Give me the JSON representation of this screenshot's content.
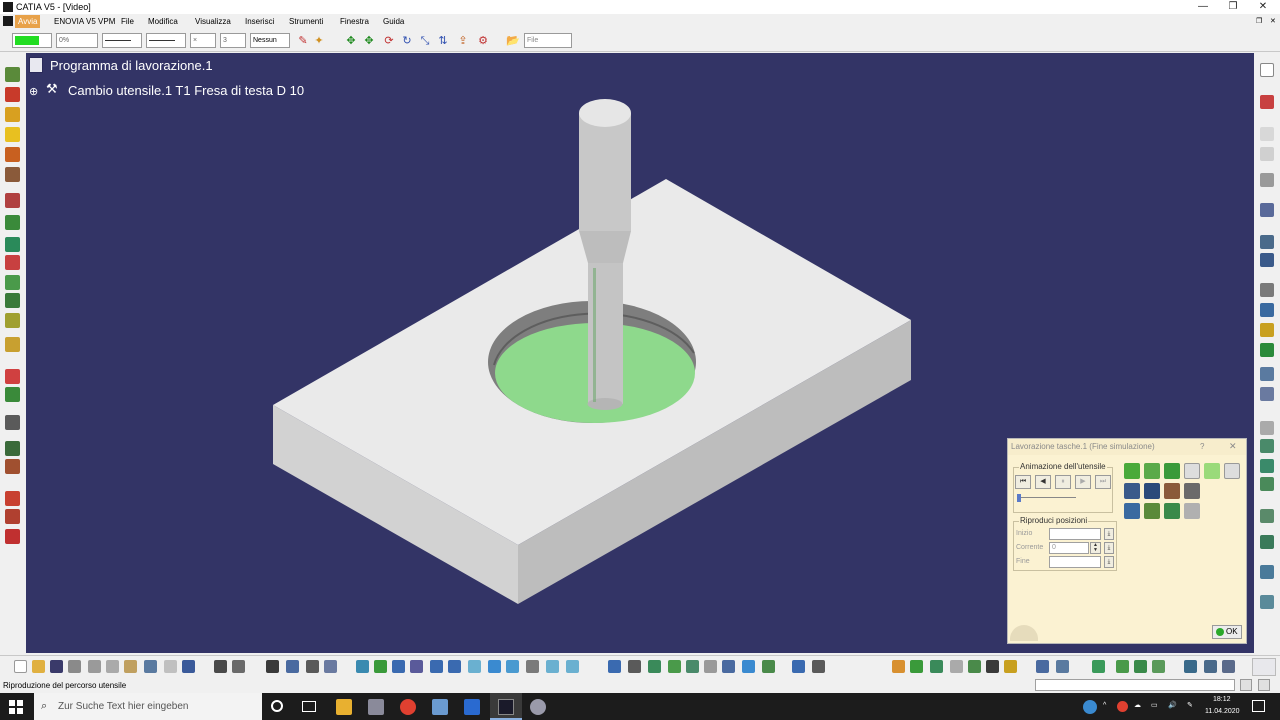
{
  "window": {
    "title": "CATIA V5 - [Video]",
    "controls": [
      "—",
      "❐",
      "✕"
    ]
  },
  "menubar": {
    "items": [
      "Avvia",
      "ENOVIA V5 VPM",
      "File",
      "Modifica",
      "Visualizza",
      "Inserisci",
      "Strumenti",
      "Finestra",
      "Guida"
    ],
    "active": "Avvia"
  },
  "toolbar_top": {
    "color_value": "",
    "color_swatch": "#22dd22",
    "transparency": "0%",
    "layer": "Nessun",
    "file_filter": "File"
  },
  "tree": {
    "root": "Programma di lavorazione.1",
    "child": "Cambio utensile.1  T1 Fresa di testa D 10"
  },
  "sim_dialog": {
    "title": "Lavorazione tasche.1 (Fine simulazione)",
    "help": "?",
    "close": "✕",
    "animation_group": "Animazione dell'utensile",
    "replay_group": "Riproduci posizioni",
    "inizio_label": "Inizio",
    "corrente_label": "Corrente",
    "corrente_value": "0",
    "fine_label": "Fine",
    "ok_label": "OK",
    "play_buttons": [
      "⏮",
      "◀",
      "⏸",
      "▶",
      "⏭"
    ]
  },
  "statusbar": {
    "text": "Riproduzione del percorso utensile"
  },
  "taskbar": {
    "search_placeholder": "Zur Suche Text hier eingeben",
    "time": "18:12",
    "date": "11.04.2020"
  },
  "colors": {
    "viewport_bg": "#333466",
    "part_top": "#eaeaea",
    "part_front": "#cfcfcf",
    "part_side": "#bcbcbc",
    "pocket_green": "#8ed98c",
    "tool_gray": "#c8c8c8"
  }
}
